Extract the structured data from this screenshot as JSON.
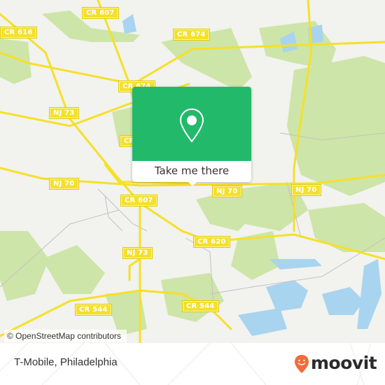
{
  "map": {
    "road_labels": [
      {
        "id": "cr-607-top",
        "text": "CR 607"
      },
      {
        "id": "cr-616",
        "text": "CR 616"
      },
      {
        "id": "cr-674-top",
        "text": "CR 674"
      },
      {
        "id": "cr-674-mid",
        "text": "CR 674"
      },
      {
        "id": "nj-73-upper",
        "text": "NJ 73"
      },
      {
        "id": "cr-partial",
        "text": "CR"
      },
      {
        "id": "nj-70-left",
        "text": "NJ 70"
      },
      {
        "id": "cr-607-mid",
        "text": "CR 607"
      },
      {
        "id": "nj-70-center",
        "text": "NJ 70"
      },
      {
        "id": "nj-70-right",
        "text": "NJ 70"
      },
      {
        "id": "cr-620",
        "text": "CR 620"
      },
      {
        "id": "nj-73-lower",
        "text": "NJ 73"
      },
      {
        "id": "cr-544-left",
        "text": "CR 544"
      },
      {
        "id": "cr-544-right",
        "text": "CR 544"
      }
    ],
    "attribution": "© OpenStreetMap contributors",
    "colors": {
      "land": "#f2f2ee",
      "park": "#cde5a8",
      "water": "#a8d4ef",
      "road": "#f5e02a"
    }
  },
  "popup": {
    "icon": "map-pin-icon",
    "cta_label": "Take me there",
    "accent_color": "#22b96b"
  },
  "footer": {
    "place_title": "T-Mobile, Philadelphia",
    "brand": "moovit",
    "brand_color": "#f26b3a"
  }
}
